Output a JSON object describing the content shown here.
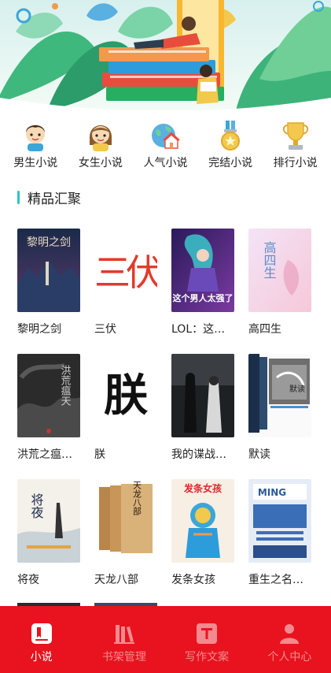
{
  "categories": [
    {
      "label": "男生小说",
      "icon": "boy-icon"
    },
    {
      "label": "女生小说",
      "icon": "girl-icon"
    },
    {
      "label": "人气小说",
      "icon": "globe-house-icon"
    },
    {
      "label": "完结小说",
      "icon": "medal-icon"
    },
    {
      "label": "排行小说",
      "icon": "trophy-icon"
    }
  ],
  "section": {
    "title": "精品汇聚",
    "accent": "#2ec4c4"
  },
  "books": [
    {
      "title": "黎明之剑",
      "cover_text": "黎明之剑"
    },
    {
      "title": "三伏",
      "cover_text": "三伏"
    },
    {
      "title": "LOL：这…",
      "cover_text": "这个男人太强了"
    },
    {
      "title": "高四生",
      "cover_text": "高四生"
    },
    {
      "title": "洪荒之瘟…",
      "cover_text": "洪荒瘟天"
    },
    {
      "title": "朕",
      "cover_text": "朕"
    },
    {
      "title": "我的谍战…",
      "cover_text": ""
    },
    {
      "title": "默读",
      "cover_text": "默读"
    },
    {
      "title": "将夜",
      "cover_text": "将夜"
    },
    {
      "title": "天龙八部",
      "cover_text": "天龙八部"
    },
    {
      "title": "发条女孩",
      "cover_text": "发条女孩"
    },
    {
      "title": "重生之名…",
      "cover_text": "MING"
    }
  ],
  "nav": [
    {
      "label": "小说",
      "icon": "book-icon",
      "active": true
    },
    {
      "label": "书架管理",
      "icon": "bookshelf-icon",
      "active": false
    },
    {
      "label": "写作文案",
      "icon": "text-t-icon",
      "active": false
    },
    {
      "label": "个人中心",
      "icon": "person-icon",
      "active": false
    }
  ],
  "colors": {
    "nav_bg": "#e8131e",
    "nav_active": "#ffffff",
    "nav_inactive": "#f28a8f"
  }
}
